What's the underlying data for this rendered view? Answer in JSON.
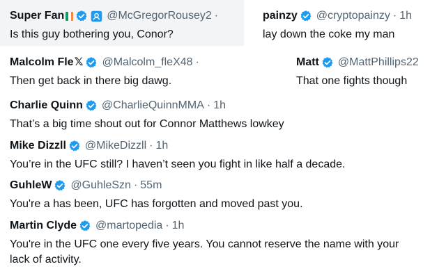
{
  "colors": {
    "text": "#0f1419",
    "secondary": "#536471",
    "verified": "#1d9bf0",
    "flag_green": "#169b62",
    "flag_white": "#ffffff",
    "flag_orange": "#ff883e"
  },
  "icons": {
    "verified": "verified-badge-icon",
    "id": "id-card-icon",
    "flag": "ireland-flag-icon"
  },
  "tweets": [
    {
      "name": "Super Fan",
      "handle": "@McGregorRousey2",
      "dot": "·",
      "text": "Is this guy bothering you, Conor?"
    },
    {
      "name": "painzy",
      "handle": "@cryptopainzy",
      "dot": "·",
      "time": "1h",
      "text": "lay down the coke my man"
    },
    {
      "name": "Malcolm Fle",
      "name_suffix": "𝕏",
      "handle": "@Malcolm_fleX48",
      "dot": "·",
      "text": "Then get back in there big dawg."
    },
    {
      "name": "Matt",
      "handle": "@MattPhillips22",
      "text": "That one fights though"
    },
    {
      "name": "Charlie Quinn",
      "handle": "@CharlieQuinnMMA",
      "dot": "·",
      "time": "1h",
      "text": "That’s a big time shout out for Connor Matthews lowkey"
    },
    {
      "name": "Mike Dizzll",
      "handle": "@MikeDizzll",
      "dot": "·",
      "time": "1h",
      "text": "You’re in the UFC still? I haven’t seen you fight in like half a decade."
    },
    {
      "name": "GuhleW",
      "handle": "@GuhleSzn",
      "dot": "·",
      "time": "55m",
      "text": "You're a has been, UFC has forgotten and moved past you."
    },
    {
      "name": "Martin Clyde",
      "handle": "@martopedia",
      "dot": "·",
      "time": "1h",
      "text": "You're in the UFC one every five years. You cannot reserve the name with your lack of activity."
    }
  ]
}
